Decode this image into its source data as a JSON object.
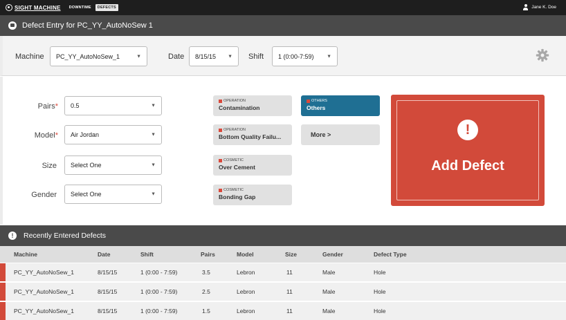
{
  "nav": {
    "brand": "SIGHT MACHINE",
    "items": [
      {
        "label": "DOWNTIME"
      },
      {
        "label": "DEFECTS"
      }
    ],
    "user": "Jane K. Doe"
  },
  "title": "Defect Entry for PC_YY_AutoNoSew 1",
  "selectors": {
    "machine_label": "Machine",
    "machine_value": "PC_YY_AutoNoSew_1",
    "date_label": "Date",
    "date_value": "8/15/15",
    "shift_label": "Shift",
    "shift_value": "1  (0:00-7:59)"
  },
  "form": {
    "pairs_label": "Pairs",
    "pairs_value": "0.5",
    "model_label": "Model",
    "model_value": "Air Jordan",
    "size_label": "Size",
    "size_value": "Select One",
    "gender_label": "Gender",
    "gender_value": "Select One",
    "required_mark": "*"
  },
  "defect_tiles": [
    {
      "category": "OPERATION",
      "name": "Contamination"
    },
    {
      "category": "OPERATION",
      "name": "Bottom Quality Failu..."
    },
    {
      "category": "COSMETIC",
      "name": "Over Cement"
    },
    {
      "category": "COSMETIC",
      "name": "Bonding Gap"
    },
    {
      "category": "OTHERS",
      "name": "Others"
    }
  ],
  "more_label": "More  >",
  "add_defect": {
    "icon": "!",
    "label": "Add Defect"
  },
  "recent": {
    "icon": "!",
    "title": "Recently Entered Defects",
    "columns": [
      "Machine",
      "Date",
      "Shift",
      "Pairs",
      "Model",
      "Size",
      "Gender",
      "Defect Type"
    ],
    "rows": [
      [
        "PC_YY_AutoNoSew_1",
        "8/15/15",
        "1 (0:00 - 7:59)",
        "3.5",
        "Lebron",
        "11",
        "Male",
        "Hole"
      ],
      [
        "PC_YY_AutoNoSew_1",
        "8/15/15",
        "1 (0:00 - 7:59)",
        "2.5",
        "Lebron",
        "11",
        "Male",
        "Hole"
      ],
      [
        "PC_YY_AutoNoSew_1",
        "8/15/15",
        "1 (0:00 - 7:59)",
        "1.5",
        "Lebron",
        "11",
        "Male",
        "Hole"
      ]
    ]
  },
  "colors": {
    "accent_red": "#d24a3a",
    "selected_blue": "#1f6f93",
    "header_dark": "#4a4a4a",
    "nav_black": "#1e1e1e"
  }
}
